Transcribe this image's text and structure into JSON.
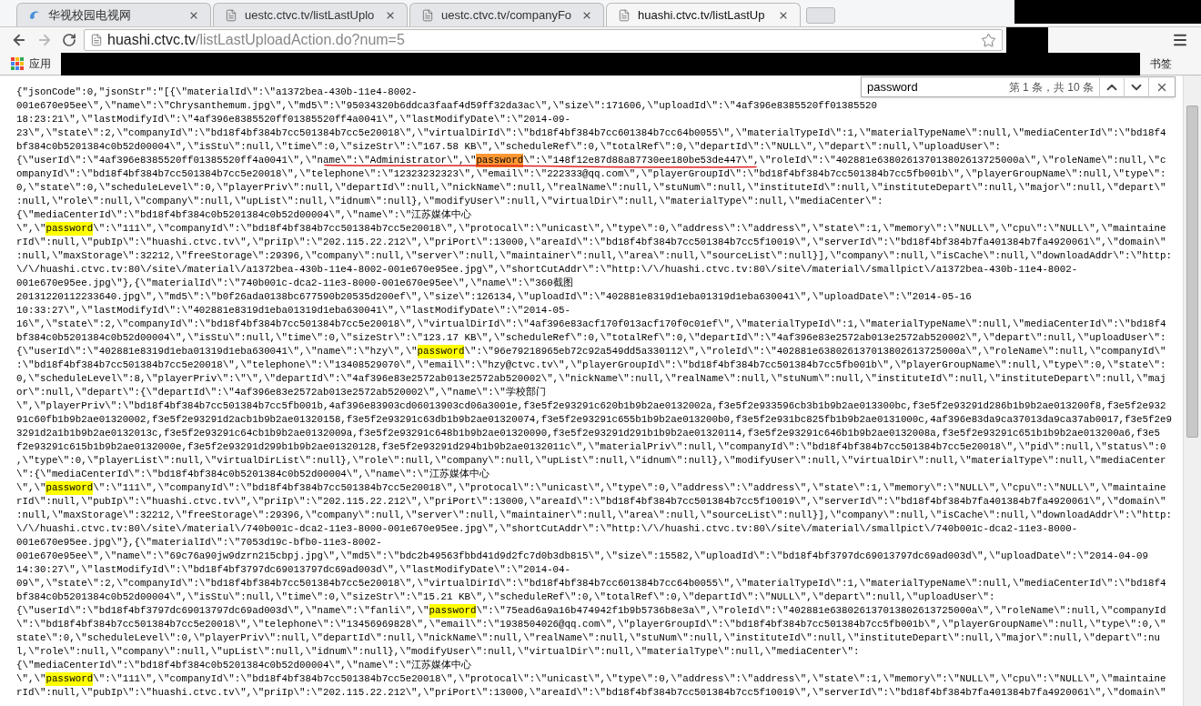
{
  "tabs": [
    {
      "title": "华视校园电视网",
      "kind": "site",
      "selected": false
    },
    {
      "title": "uestc.ctvc.tv/listLastUplo",
      "kind": "page",
      "selected": false
    },
    {
      "title": "uestc.ctvc.tv/companyFo",
      "kind": "page",
      "selected": false
    },
    {
      "title": "huashi.ctvc.tv/listLastUp",
      "kind": "page",
      "selected": true
    }
  ],
  "address_bar": {
    "host": "huashi.ctvc.tv",
    "path": "/listLastUploadAction.do?num=5"
  },
  "bookmarks_bar": {
    "apps_label": "应用",
    "trailing_label": "书签"
  },
  "find_bar": {
    "query": "password",
    "result": "第 1 条，共 10 条"
  },
  "lines": [
    [
      {
        "text": "{\"jsonCode\":0,\"jsonStr\":\"[{\\\"materialId\\\":\\\"a1372bea-430b-11e4-8002-"
      }
    ],
    [
      {
        "text": "001e670e95ee\\\",\\\"name\\\":\\\"Chrysanthemum.jpg\\\",\\\"md5\\\":\\\"95034320b6ddca3faaf4d59ff32da3ac\\\",\\\"size\\\":171606,\\\"uploadId\\\":\\\"4af396e8385520ff01385520"
      }
    ],
    [
      {
        "text": "18:23:21\\\",\\\"lastModifyId\\\":\\\"4af396e8385520ff01385520ff4a0041\\\",\\\"lastModifyDate\\\":\\\"2014-09-"
      }
    ],
    [
      {
        "text": "23\\\",\\\"state\\\":2,\\\"companyId\\\":\\\"bd18f4bf384b7cc501384b7cc5e20018\\\",\\\"virtualDirId\\\":\\\"bd18f4bf384b7cc601384b7cc64b0055\\\",\\\"materialTypeId\\\":1,\\\"materialTypeName\\\":null,\\\"mediaCenterId\\\":\\\"bd18f4"
      }
    ],
    [
      {
        "text": "bf384c0b5201384c0b52d00004\\\",\\\"isStu\\\":null,\\\"time\\\":0,\\\"sizeStr\\\":\\\"167.58 KB\\\",\\\"scheduleRef\\\":0,\\\"totalRef\\\":0,\\\"departId\\\":\\\"NULL\\\",\\\"depart\\\":null,\\\"uploadUser\\\":"
      }
    ],
    [
      {
        "text": "{\\\"userId\\\":\\\"4af396e8385520ff01385520ff4a0041\\\",\\\"name\\\":\\\"Administrator\\\",\\\""
      },
      {
        "text": "password",
        "match": true,
        "current": true
      },
      {
        "text": "\\\":\\\"148f12e87d88a87730ee180be53de447\\\",\\\"roleId\\\":\\\"402881e638026137013802613725000a\\\",\\\"roleName\\\":null,\\\"c"
      }
    ],
    [
      {
        "text": "ompanyId\\\":\\\"bd18f4bf384b7cc501384b7cc5e20018\\\",\\\"telephone\\\":\\\"12323232323\\\",\\\"email\\\":\\\"222333@qq.com\\\",\\\"playerGroupId\\\":\\\"bd18f4bf384b7cc501384b7cc5fb001b\\\",\\\"playerGroupName\\\":null,\\\"type\\\":"
      }
    ],
    [
      {
        "text": "0,\\\"state\\\":0,\\\"scheduleLevel\\\":0,\\\"playerPriv\\\":null,\\\"departId\\\":null,\\\"nickName\\\":null,\\\"realName\\\":null,\\\"stuNum\\\":null,\\\"instituteId\\\":null,\\\"instituteDepart\\\":null,\\\"major\\\":null,\\\"depart\\\""
      }
    ],
    [
      {
        "text": ":null,\\\"role\\\":null,\\\"company\\\":null,\\\"upList\\\":null,\\\"idnum\\\":null},\\\"modifyUser\\\":null,\\\"virtualDir\\\":null,\\\"materialType\\\":null,\\\"mediaCenter\\\":"
      }
    ],
    [
      {
        "text": "{\\\"mediaCenterId\\\":\\\"bd18f4bf384c0b5201384c0b52d00004\\\",\\\"name\\\":\\\"江苏媒体中心"
      }
    ],
    [
      {
        "text": "\\\",\\\""
      },
      {
        "text": "password",
        "match": true,
        "current": false
      },
      {
        "text": "\\\":\\\"111\\\",\\\"companyId\\\":\\\"bd18f4bf384b7cc501384b7cc5e20018\\\",\\\"protocal\\\":\\\"unicast\\\",\\\"type\\\":0,\\\"address\\\":\\\"address\\\",\\\"state\\\":1,\\\"memory\\\":\\\"NULL\\\",\\\"cpu\\\":\\\"NULL\\\",\\\"maintaine"
      }
    ],
    [
      {
        "text": "rId\\\":null,\\\"pubIp\\\":\\\"huashi.ctvc.tv\\\",\\\"priIp\\\":\\\"202.115.22.212\\\",\\\"priPort\\\":13000,\\\"areaId\\\":\\\"bd18f4bf384b7cc501384b7cc5f10019\\\",\\\"serverId\\\":\\\"bd18f4bf384b7fa401384b7fa4920061\\\",\\\"domain\\\""
      }
    ],
    [
      {
        "text": ":null,\\\"maxStorage\\\":32212,\\\"freeStorage\\\":29396,\\\"company\\\":null,\\\"server\\\":null,\\\"maintainer\\\":null,\\\"area\\\":null,\\\"sourceList\\\":null}],\\\"company\\\":null,\\\"isCache\\\":null,\\\"downloadAddr\\\":\\\"http:"
      }
    ],
    [
      {
        "text": "\\/\\/huashi.ctvc.tv:80\\/site\\/material\\/a1372bea-430b-11e4-8002-001e670e95ee.jpg\\\",\\\"shortCutAddr\\\":\\\"http:\\/\\/huashi.ctvc.tv:80\\/site\\/material\\/smallpict\\/a1372bea-430b-11e4-8002-"
      }
    ],
    [
      {
        "text": "001e670e95ee.jpg\\\"},{\\\"materialId\\\":\\\"740b001c-dca2-11e3-8000-001e670e95ee\\\",\\\"name\\\":\\\"360截图"
      }
    ],
    [
      {
        "text": "20131220112233640.jpg\\\",\\\"md5\\\":\\\"b0f26ada0138bc677590b20535d200ef\\\",\\\"size\\\":126134,\\\"uploadId\\\":\\\"402881e8319d1eba01319d1eba630041\\\",\\\"uploadDate\\\":\\\"2014-05-16"
      }
    ],
    [
      {
        "text": "10:33:27\\\",\\\"lastModifyId\\\":\\\"402881e8319d1eba01319d1eba630041\\\",\\\"lastModifyDate\\\":\\\"2014-05-"
      }
    ],
    [
      {
        "text": "16\\\",\\\"state\\\":2,\\\"companyId\\\":\\\"bd18f4bf384b7cc501384b7cc5e20018\\\",\\\"virtualDirId\\\":\\\"4af396e83acf170f013acf170f0c01ef\\\",\\\"materialTypeId\\\":1,\\\"materialTypeName\\\":null,\\\"mediaCenterId\\\":\\\"bd18f4"
      }
    ],
    [
      {
        "text": "bf384c0b5201384c0b52d00004\\\",\\\"isStu\\\":null,\\\"time\\\":0,\\\"sizeStr\\\":\\\"123.17 KB\\\",\\\"scheduleRef\\\":0,\\\"totalRef\\\":0,\\\"departId\\\":\\\"4af396e83e2572ab013e2572ab520002\\\",\\\"depart\\\":null,\\\"uploadUser\\\":"
      }
    ],
    [
      {
        "text": "{\\\"userId\\\":\\\"402881e8319d1eba01319d1eba630041\\\",\\\"name\\\":\\\"hzy\\\",\\\""
      },
      {
        "text": "password",
        "match": true,
        "current": false
      },
      {
        "text": "\\\":\\\"96e79218965eb72c92a549dd5a330112\\\",\\\"roleId\\\":\\\"402881e638026137013802613725000a\\\",\\\"roleName\\\":null,\\\"companyId\\\""
      }
    ],
    [
      {
        "text": ":\\\"bd18f4bf384b7cc501384b7cc5e20018\\\",\\\"telephone\\\":\\\"13408529070\\\",\\\"email\\\":\\\"hzy@ctvc.tv\\\",\\\"playerGroupId\\\":\\\"bd18f4bf384b7cc501384b7cc5fb001b\\\",\\\"playerGroupName\\\":null,\\\"type\\\":0,\\\"state\\\":"
      }
    ],
    [
      {
        "text": "0,\\\"scheduleLevel\\\":8,\\\"playerPriv\\\":\\\"\\\",\\\"departId\\\":\\\"4af396e83e2572ab013e2572ab520002\\\",\\\"nickName\\\":null,\\\"realName\\\":null,\\\"stuNum\\\":null,\\\"instituteId\\\":null,\\\"instituteDepart\\\":null,\\\"maj"
      }
    ],
    [
      {
        "text": "or\\\":null,\\\"depart\\\":{\\\"departId\\\":\\\"4af396e83e2572ab013e2572ab520002\\\",\\\"name\\\":\\\"学校部门"
      }
    ],
    [
      {
        "text": "\\\",\\\"playerPriv\\\":\\\"bd18f4bf384b7cc501384b7cc5fb001b,4af396e83903cd06013903cd06a3001e,f3e5f2e93291c620b1b9b2ae0132002a,f3e5f2e933596cb3b1b9b2ae013300bc,f3e5f2e93291d286b1b9b2ae013200f8,f3e5f2e932"
      }
    ],
    [
      {
        "text": "91c60fb1b9b2ae01320002,f3e5f2e93291d2acb1b9b2ae01320158,f3e5f2e93291c63db1b9b2ae01320074,f3e5f2e93291c655b1b9b2ae013200b0,f3e5f2e931bc825fb1b9b2ae0131000c,4af396e83da9ca37013da9ca37ab0017,f3e5f2e9"
      }
    ],
    [
      {
        "text": "3291d2a1b1b9b2ae0132013c,f3e5f2e93291c64cb1b9b2ae0132009a,f3e5f2e93291c648b1b9b2ae01320090,f3e5f2e93291d291b1b9b2ae01320114,f3e5f2e93291c646b1b9b2ae0132008a,f3e5f2e93291c651b1b9b2ae013200a6,f3e5"
      }
    ],
    [
      {
        "text": "f2e93291c615b1b9b2ae0132000e,f3e5f2e93291d299b1b9b2ae01320128,f3e5f2e93291d294b1b9b2ae0132011c\\\",\\\"materialPriv\\\":null,\\\"companyId\\\":\\\"bd18f4bf384b7cc501384b7cc5e20018\\\",\\\"pid\\\":null,\\\"status\\\":0"
      }
    ],
    [
      {
        "text": ",\\\"type\\\":0,\\\"playerList\\\":null,\\\"virtualDirList\\\":null},\\\"role\\\":null,\\\"company\\\":null,\\\"upList\\\":null,\\\"idnum\\\":null},\\\"modifyUser\\\":null,\\\"virtualDir\\\":null,\\\"materialType\\\":null,\\\"mediaCenter"
      }
    ],
    [
      {
        "text": "\\\":{\\\"mediaCenterId\\\":\\\"bd18f4bf384c0b5201384c0b52d00004\\\",\\\"name\\\":\\\"江苏媒体中心"
      }
    ],
    [
      {
        "text": "\\\",\\\""
      },
      {
        "text": "password",
        "match": true,
        "current": false
      },
      {
        "text": "\\\":\\\"111\\\",\\\"companyId\\\":\\\"bd18f4bf384b7cc501384b7cc5e20018\\\",\\\"protocal\\\":\\\"unicast\\\",\\\"type\\\":0,\\\"address\\\":\\\"address\\\",\\\"state\\\":1,\\\"memory\\\":\\\"NULL\\\",\\\"cpu\\\":\\\"NULL\\\",\\\"maintaine"
      }
    ],
    [
      {
        "text": "rId\\\":null,\\\"pubIp\\\":\\\"huashi.ctvc.tv\\\",\\\"priIp\\\":\\\"202.115.22.212\\\",\\\"priPort\\\":13000,\\\"areaId\\\":\\\"bd18f4bf384b7cc501384b7cc5f10019\\\",\\\"serverId\\\":\\\"bd18f4bf384b7fa401384b7fa4920061\\\",\\\"domain\\\""
      }
    ],
    [
      {
        "text": ":null,\\\"maxStorage\\\":32212,\\\"freeStorage\\\":29396,\\\"company\\\":null,\\\"server\\\":null,\\\"maintainer\\\":null,\\\"area\\\":null,\\\"sourceList\\\":null}],\\\"company\\\":null,\\\"isCache\\\":null,\\\"downloadAddr\\\":\\\"http:"
      }
    ],
    [
      {
        "text": "\\/\\/huashi.ctvc.tv:80\\/site\\/material\\/740b001c-dca2-11e3-8000-001e670e95ee.jpg\\\",\\\"shortCutAddr\\\":\\\"http:\\/\\/huashi.ctvc.tv:80\\/site\\/material\\/smallpict\\/740b001c-dca2-11e3-8000-"
      }
    ],
    [
      {
        "text": "001e670e95ee.jpg\\\"},{\\\"materialId\\\":\\\"7053d19c-bfb0-11e3-8002-"
      }
    ],
    [
      {
        "text": "001e670e95ee\\\",\\\"name\\\":\\\"69c76a90jw9dzrn215cbpj.jpg\\\",\\\"md5\\\":\\\"bdc2b49563fbbd41d9d2fc7d0b3db815\\\",\\\"size\\\":15582,\\\"uploadId\\\":\\\"bd18f4bf3797dc69013797dc69ad003d\\\",\\\"uploadDate\\\":\\\"2014-04-09"
      }
    ],
    [
      {
        "text": "14:30:27\\\",\\\"lastModifyId\\\":\\\"bd18f4bf3797dc69013797dc69ad003d\\\",\\\"lastModifyDate\\\":\\\"2014-04-"
      }
    ],
    [
      {
        "text": "09\\\",\\\"state\\\":2,\\\"companyId\\\":\\\"bd18f4bf384b7cc501384b7cc5e20018\\\",\\\"virtualDirId\\\":\\\"bd18f4bf384b7cc601384b7cc64b0055\\\",\\\"materialTypeId\\\":1,\\\"materialTypeName\\\":null,\\\"mediaCenterId\\\":\\\"bd18f4"
      }
    ],
    [
      {
        "text": "bf384c0b5201384c0b52d00004\\\",\\\"isStu\\\":null,\\\"time\\\":0,\\\"sizeStr\\\":\\\"15.21 KB\\\",\\\"scheduleRef\\\":0,\\\"totalRef\\\":0,\\\"departId\\\":\\\"NULL\\\",\\\"depart\\\":null,\\\"uploadUser\\\":"
      }
    ],
    [
      {
        "text": "{\\\"userId\\\":\\\"bd18f4bf3797dc69013797dc69ad003d\\\",\\\"name\\\":\\\"fanli\\\",\\\""
      },
      {
        "text": "password",
        "match": true,
        "current": false
      },
      {
        "text": "\\\":\\\"75ead6a9a16b474942f1b9b5736b8e3a\\\",\\\"roleId\\\":\\\"402881e638026137013802613725000a\\\",\\\"roleName\\\":null,\\\"companyId"
      }
    ],
    [
      {
        "text": "\\\":\\\"bd18f4bf384b7cc501384b7cc5e20018\\\",\\\"telephone\\\":\\\"13456969828\\\",\\\"email\\\":\\\"1938504026@qq.com\\\",\\\"playerGroupId\\\":\\\"bd18f4bf384b7cc501384b7cc5fb001b\\\",\\\"playerGroupName\\\":null,\\\"type\\\":0,\\\""
      }
    ],
    [
      {
        "text": "state\\\":0,\\\"scheduleLevel\\\":0,\\\"playerPriv\\\":null,\\\"departId\\\":null,\\\"nickName\\\":null,\\\"realName\\\":null,\\\"stuNum\\\":null,\\\"instituteId\\\":null,\\\"instituteDepart\\\":null,\\\"major\\\":null,\\\"depart\\\":nu"
      }
    ],
    [
      {
        "text": "l,\\\"role\\\":null,\\\"company\\\":null,\\\"upList\\\":null,\\\"idnum\\\":null},\\\"modifyUser\\\":null,\\\"virtualDir\\\":null,\\\"materialType\\\":null,\\\"mediaCenter\\\":"
      }
    ],
    [
      {
        "text": "{\\\"mediaCenterId\\\":\\\"bd18f4bf384c0b5201384c0b52d00004\\\",\\\"name\\\":\\\"江苏媒体中心"
      }
    ],
    [
      {
        "text": "\\\",\\\""
      },
      {
        "text": "password",
        "match": true,
        "current": false
      },
      {
        "text": "\\\":\\\"111\\\",\\\"companyId\\\":\\\"bd18f4bf384b7cc501384b7cc5e20018\\\",\\\"protocal\\\":\\\"unicast\\\",\\\"type\\\":0,\\\"address\\\":\\\"address\\\",\\\"state\\\":1,\\\"memory\\\":\\\"NULL\\\",\\\"cpu\\\":\\\"NULL\\\",\\\"maintaine"
      }
    ],
    [
      {
        "text": "rId\\\":null,\\\"pubIp\\\":\\\"huashi.ctvc.tv\\\",\\\"priIp\\\":\\\"202.115.22.212\\\",\\\"priPort\\\":13000,\\\"areaId\\\":\\\"bd18f4bf384b7cc501384b7cc5f10019\\\",\\\"serverId\\\":\\\"bd18f4bf384b7fa401384b7fa4920061\\\",\\\"domain\\\""
      }
    ]
  ]
}
